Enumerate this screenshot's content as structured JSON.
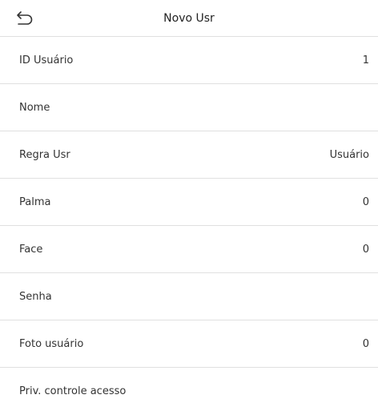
{
  "header": {
    "back_icon": "undo-arrow-icon",
    "title": "Novo Usr"
  },
  "rows": [
    {
      "name": "user-id",
      "label": "ID Usuário",
      "value": "1"
    },
    {
      "name": "name",
      "label": "Nome",
      "value": ""
    },
    {
      "name": "user-role",
      "label": "Regra Usr",
      "value": "Usuário"
    },
    {
      "name": "palm",
      "label": "Palma",
      "value": "0"
    },
    {
      "name": "face",
      "label": "Face",
      "value": "0"
    },
    {
      "name": "password",
      "label": "Senha",
      "value": ""
    },
    {
      "name": "user-photo",
      "label": "Foto usuário",
      "value": "0"
    },
    {
      "name": "access-control",
      "label": "Priv. controle acesso",
      "value": ""
    }
  ],
  "colors": {
    "background": "#ffffff",
    "divider": "#e0e0e0",
    "text": "#333333"
  }
}
